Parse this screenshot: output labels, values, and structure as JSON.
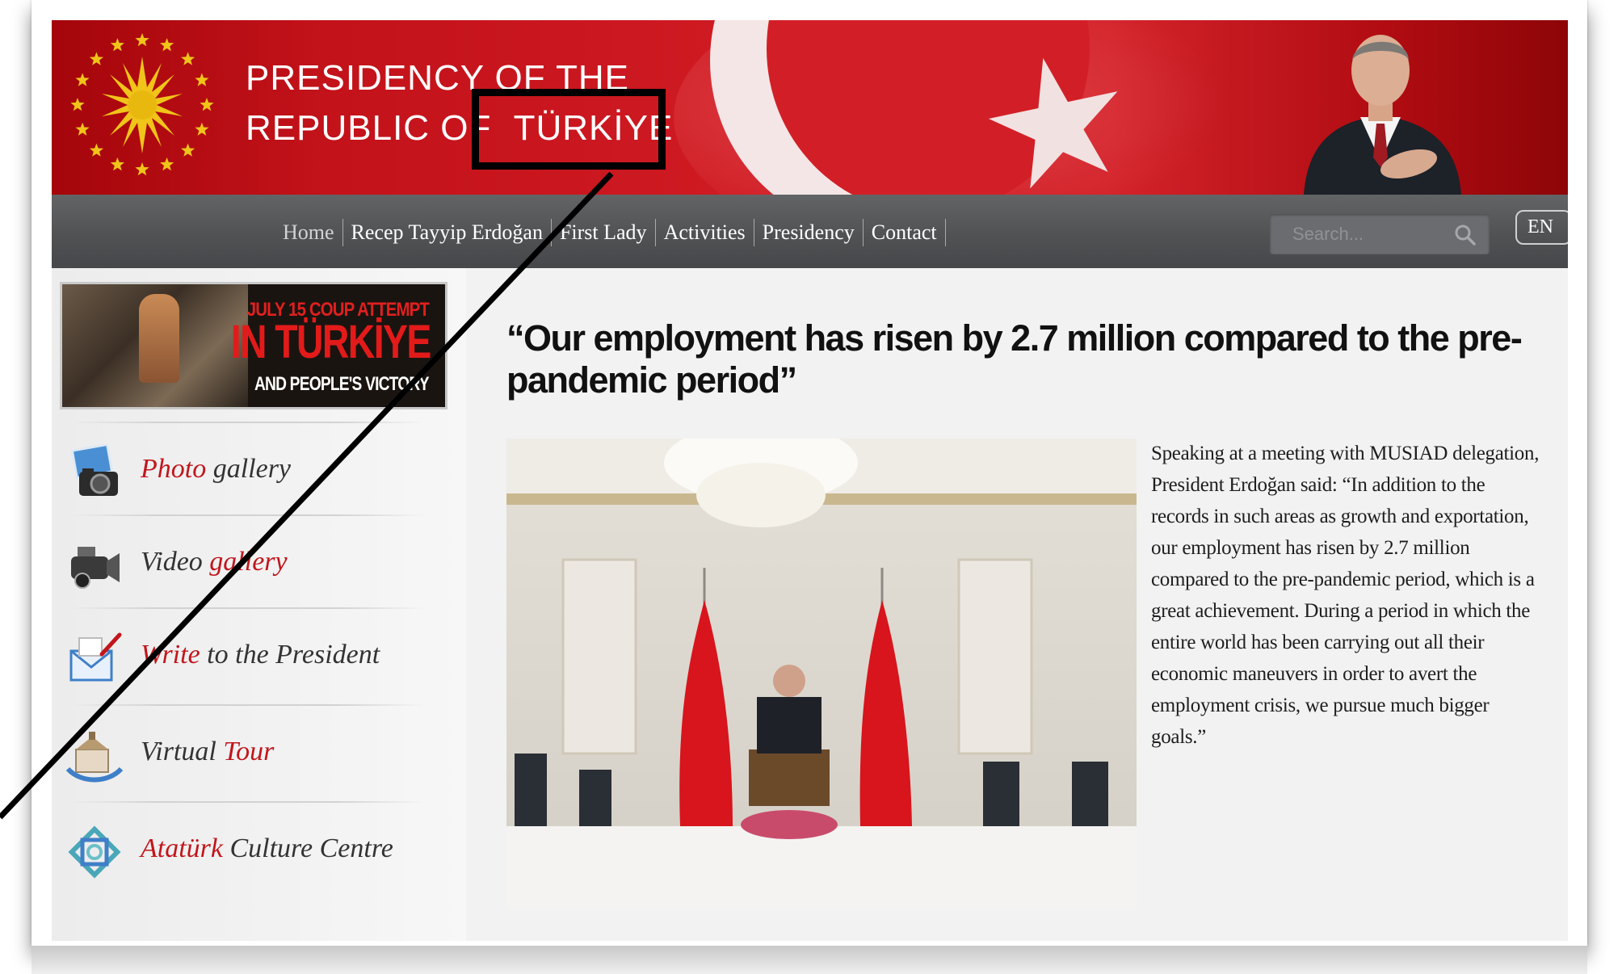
{
  "header": {
    "title_line1": "PRESIDENCY OF THE",
    "title_line2_part1": "REPUBLIC OF",
    "title_line2_part2": "TÜRKİYE"
  },
  "nav": {
    "items": [
      "Home",
      "Recep Tayyip Erdoğan",
      "First Lady",
      "Activities",
      "Presidency",
      "Contact"
    ],
    "search_placeholder": "Search...",
    "language": "EN"
  },
  "sidebar": {
    "banner": {
      "line1": "JULY 15 COUP ATTEMPT",
      "line2": "IN TÜRKİYE",
      "line3": "AND PEOPLE'S VICTORY"
    },
    "links": [
      {
        "icon": "camera-icon",
        "part1": "Photo",
        "part2": " gallery"
      },
      {
        "icon": "video-camera-icon",
        "part1": "Video",
        "part2": " gallery"
      },
      {
        "icon": "letter-icon",
        "part1": "Write",
        "part2": " to the President"
      },
      {
        "icon": "building-icon",
        "part1": "Virtual",
        "part2": " Tour"
      },
      {
        "icon": "knot-emblem-icon",
        "part1": "Atatürk",
        "part2": " Culture Centre"
      }
    ]
  },
  "article": {
    "headline": "“Our employment has risen by 2.7 million compared to the pre-pandemic period”",
    "body": "Speaking at a meeting with MUSIAD delegation, President Erdoğan said: “In addition to the records in such areas as growth and exportation, our employment has risen by 2.7 million compared to the pre-pandemic period, which is a great achievement. During a period in which the entire world has been carrying out all their economic maneuvers in order to avert the employment crisis, we pursue much bigger goals.”"
  },
  "colors": {
    "header_red": "#cf1a22",
    "nav_gray": "#505254",
    "link_red": "#c1161c",
    "annotation": "#000000"
  }
}
